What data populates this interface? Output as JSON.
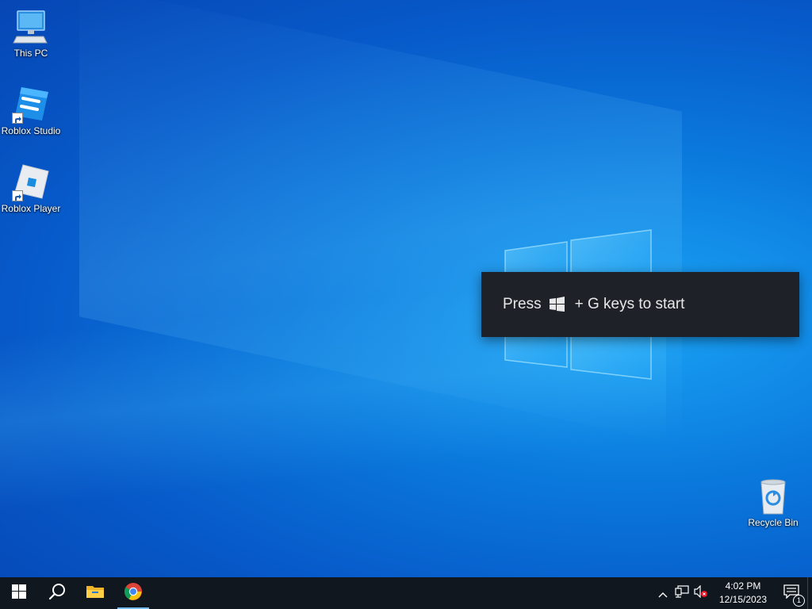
{
  "desktop": {
    "icons": [
      {
        "label": "This PC",
        "icon": "monitor-icon"
      },
      {
        "label": "Roblox Studio",
        "icon": "roblox-studio-icon"
      },
      {
        "label": "Roblox Player",
        "icon": "roblox-player-icon"
      },
      {
        "label": "Recycle Bin",
        "icon": "recycle-bin-icon"
      }
    ],
    "wallpaper_accent": "#0a78dc"
  },
  "toast": {
    "press": "Press",
    "rest": "+ G keys to start",
    "key_icon": "windows-key-icon"
  },
  "taskbar": {
    "background": "#10171f",
    "buttons": [
      "start-icon",
      "search-icon",
      "file-explorer-icon",
      "chrome-icon"
    ],
    "tray": {
      "icons": [
        "chevron-up-icon",
        "network-icon",
        "volume-muted-icon"
      ],
      "time": "4:02 PM",
      "date": "12/15/2023",
      "notification_count": "1"
    }
  }
}
